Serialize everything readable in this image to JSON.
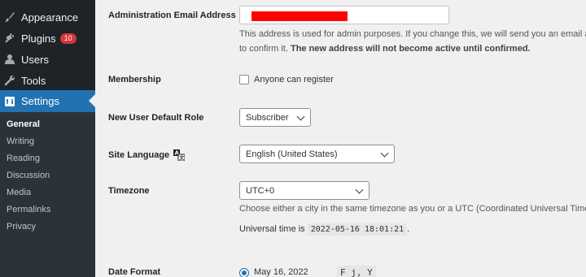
{
  "sidebar": {
    "items": [
      {
        "label": "Appearance",
        "icon": "paintbrush-icon"
      },
      {
        "label": "Plugins",
        "icon": "plugin-icon",
        "badge": "10"
      },
      {
        "label": "Users",
        "icon": "user-icon"
      },
      {
        "label": "Tools",
        "icon": "wrench-icon"
      },
      {
        "label": "Settings",
        "icon": "settings-icon",
        "active": true
      }
    ],
    "submenu": [
      "General",
      "Writing",
      "Reading",
      "Discussion",
      "Media",
      "Permalinks",
      "Privacy"
    ]
  },
  "settings": {
    "admin_email": {
      "label": "Administration Email Address",
      "value": "",
      "desc_line1": "This address is used for admin purposes. If you change this, we will send you an email at your",
      "desc_line2_pre": "to confirm it.",
      "desc_line2_bold": "The new address will not become active until confirmed."
    },
    "membership": {
      "label": "Membership",
      "checkbox_label": "Anyone can register",
      "checked": false
    },
    "default_role": {
      "label": "New User Default Role",
      "selected": "Subscriber"
    },
    "site_language": {
      "label": "Site Language",
      "selected": "English (United States)",
      "icon": "translation-icon"
    },
    "timezone": {
      "label": "Timezone",
      "selected": "UTC+0",
      "desc": "Choose either a city in the same timezone as you or a UTC (Coordinated Universal Time) time",
      "universal_prefix": "Universal time is",
      "universal_time": "2022-05-16 18:01:21",
      "universal_suffix": "."
    },
    "date_format": {
      "label": "Date Format",
      "option_label": "May 16, 2022",
      "option_code": "F j, Y"
    }
  },
  "colors": {
    "sidebar_bg": "#1d2327",
    "active_bg": "#2271b1",
    "badge_bg": "#d63638",
    "content_bg": "#f0f0f1"
  }
}
